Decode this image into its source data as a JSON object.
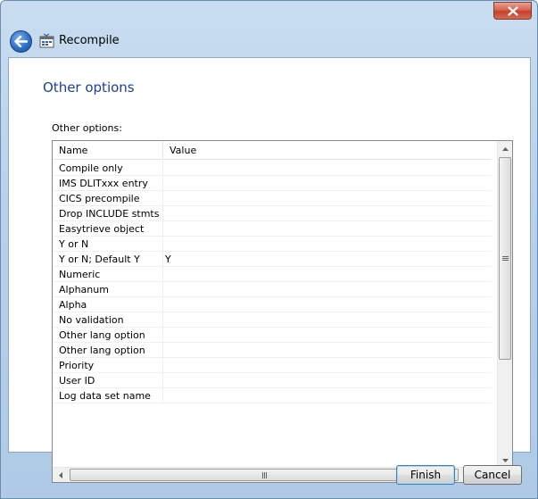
{
  "window": {
    "title": "Recompile"
  },
  "page": {
    "title": "Other options",
    "section_label": "Other options:"
  },
  "list": {
    "columns": {
      "name": "Name",
      "value": "Value"
    },
    "rows": [
      {
        "name": "Compile only",
        "value": ""
      },
      {
        "name": "IMS DLITxxx entry",
        "value": ""
      },
      {
        "name": "CICS precompile",
        "value": ""
      },
      {
        "name": "Drop INCLUDE stmts",
        "value": ""
      },
      {
        "name": "Easytrieve object",
        "value": ""
      },
      {
        "name": "Y or N",
        "value": ""
      },
      {
        "name": "Y or N; Default Y",
        "value": "Y"
      },
      {
        "name": "Numeric",
        "value": ""
      },
      {
        "name": "Alphanum",
        "value": ""
      },
      {
        "name": "Alpha",
        "value": ""
      },
      {
        "name": "No validation",
        "value": ""
      },
      {
        "name": "Other lang option",
        "value": ""
      },
      {
        "name": "Other lang option",
        "value": ""
      },
      {
        "name": "Priority",
        "value": ""
      },
      {
        "name": "User ID",
        "value": ""
      },
      {
        "name": "Log data set name",
        "value": ""
      }
    ]
  },
  "buttons": {
    "finish": "Finish",
    "cancel": "Cancel"
  }
}
